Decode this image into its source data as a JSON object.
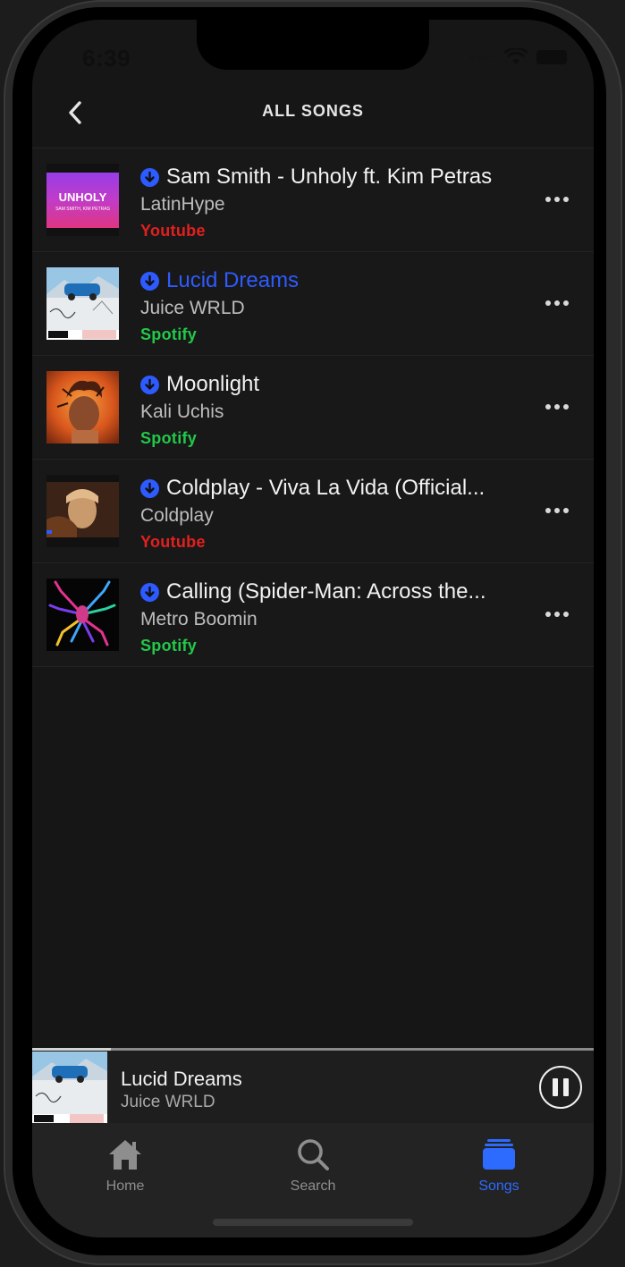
{
  "status": {
    "time": "6:39"
  },
  "header": {
    "title": "ALL SONGS"
  },
  "songs": [
    {
      "title": "Sam Smith - Unholy ft. Kim Petras",
      "artist": "LatinHype",
      "source": "Youtube",
      "active": false,
      "art_text": "UNHOLY",
      "art_subtext": "SAM SMITH, KIM PETRAS"
    },
    {
      "title": "Lucid Dreams",
      "artist": "Juice WRLD",
      "source": "Spotify",
      "active": true
    },
    {
      "title": "Moonlight",
      "artist": "Kali Uchis",
      "source": "Spotify",
      "active": false
    },
    {
      "title": "Coldplay - Viva La Vida (Official...",
      "artist": "Coldplay",
      "source": "Youtube",
      "active": false
    },
    {
      "title": "Calling (Spider-Man: Across the...",
      "artist": "Metro Boomin",
      "source": "Spotify",
      "active": false
    }
  ],
  "mini_player": {
    "title": "Lucid Dreams",
    "artist": "Juice WRLD",
    "progress": 0.14
  },
  "tabs": [
    {
      "label": "Home",
      "icon": "home-icon",
      "active": false
    },
    {
      "label": "Search",
      "icon": "search-icon",
      "active": false
    },
    {
      "label": "Songs",
      "icon": "songs-icon",
      "active": true
    }
  ],
  "colors": {
    "accent": "#2d5bff",
    "youtube": "#e22020",
    "spotify": "#23c84a",
    "background": "#161616"
  }
}
